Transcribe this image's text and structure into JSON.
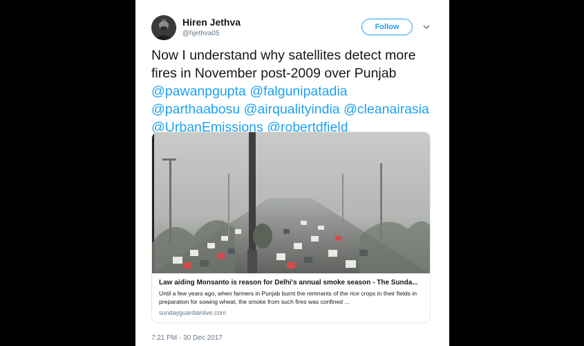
{
  "tweet": {
    "author_name": "Hiren Jethva",
    "author_handle": "@hjethva05",
    "follow_label": "Follow",
    "text_plain_1": "Now I understand why satellites detect more",
    "text_plain_2": "fires in November post-2009 over Punjab",
    "mentions": [
      "@pawanpgupta",
      "@falgunipatadia",
      "@parthaabosu",
      "@airqualityindia",
      "@cleanairasia",
      "@UrbanEmissions",
      "@robertdfield"
    ],
    "timestamp": "7:21 PM - 30 Dec 2017"
  },
  "link_card": {
    "title": "Law aiding Monsanto is reason for Delhi's annual smoke season - The Sunda...",
    "description": "Until a few years ago, when farmers in Punjab burnt the remnants of the rice crops in their fields in preparation for sowing wheat, the smoke from such fires was confined ...",
    "domain": "sundayguardianlive.com"
  },
  "colors": {
    "accent": "#1da1f2",
    "text": "#14171a",
    "muted": "#657786",
    "background": "#000000"
  },
  "icons": {
    "menu": "chevron-down-icon"
  }
}
